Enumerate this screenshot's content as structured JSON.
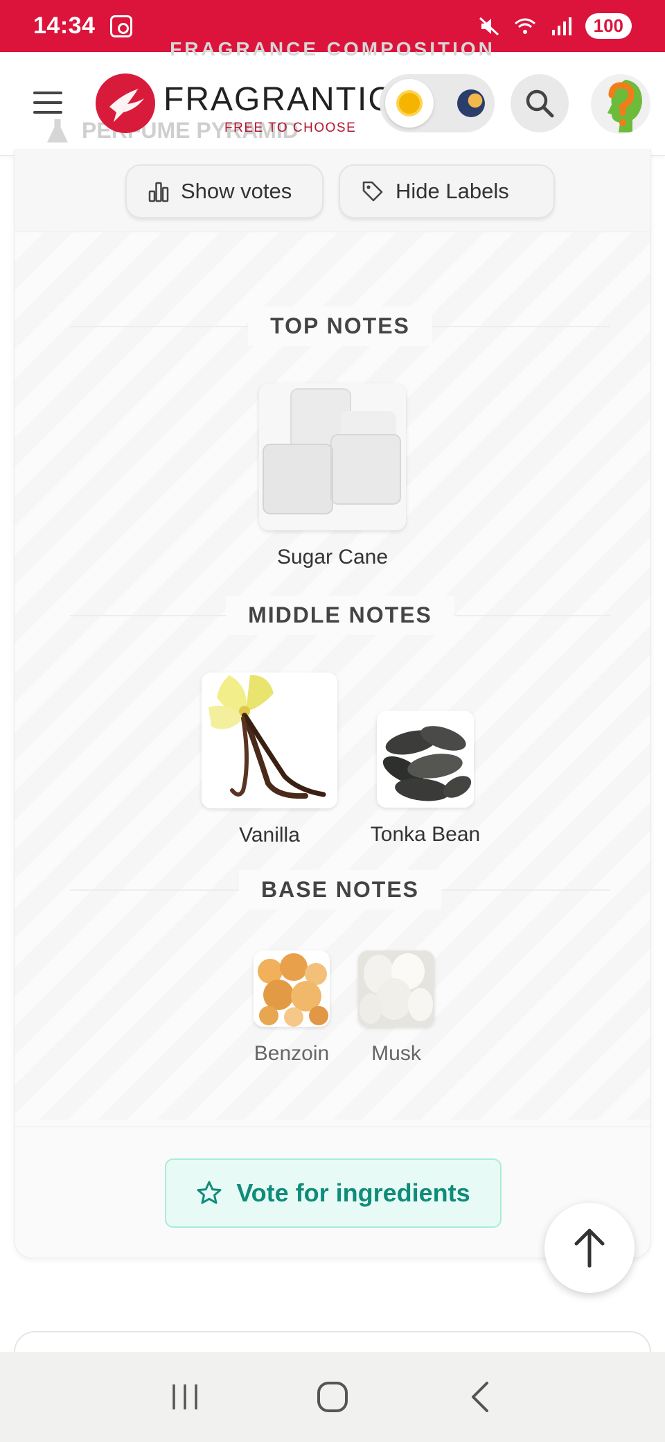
{
  "status_bar": {
    "time": "14:34",
    "battery": "100"
  },
  "header": {
    "faded_section_title": "FRAGRANCE COMPOSITION",
    "faded_pyramid_title": "PERFUME PYRAMID",
    "logo_text": "FRAGRANTICA",
    "logo_tagline": "FREE TO CHOOSE",
    "brand_color": "#dc143c"
  },
  "toolbar": {
    "show_votes_label": "Show votes",
    "hide_labels_label": "Hide Labels"
  },
  "pyramid": {
    "top_notes": {
      "title": "TOP NOTES",
      "items": [
        {
          "label": "Sugar Cane"
        }
      ]
    },
    "middle_notes": {
      "title": "MIDDLE NOTES",
      "items": [
        {
          "label": "Vanilla"
        },
        {
          "label": "Tonka Bean"
        }
      ]
    },
    "base_notes": {
      "title": "BASE NOTES",
      "items": [
        {
          "label": "Benzoin"
        },
        {
          "label": "Musk"
        }
      ]
    }
  },
  "actions": {
    "vote_label": "Vote for ingredients",
    "accent_color": "#0f8c7a"
  }
}
